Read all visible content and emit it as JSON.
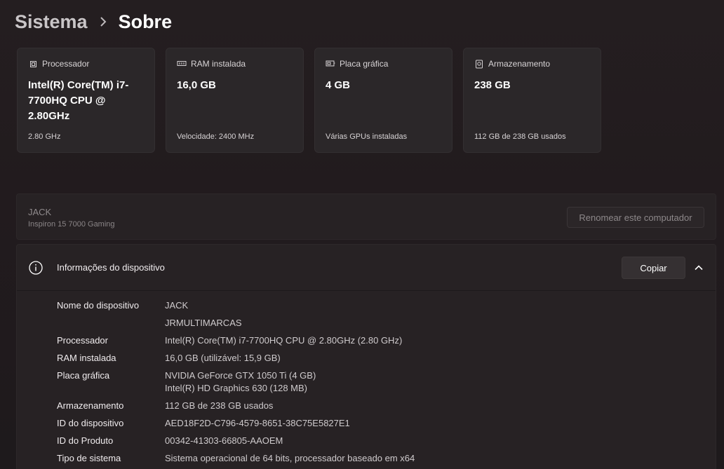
{
  "breadcrumb": {
    "parent": "Sistema",
    "separator": "›",
    "current": "Sobre"
  },
  "cards": [
    {
      "icon": "processor-icon",
      "label": "Processador",
      "value": "Intel(R) Core(TM) i7-7700HQ CPU @ 2.80GHz",
      "sub": "2.80 GHz"
    },
    {
      "icon": "ram-icon",
      "label": "RAM instalada",
      "value": "16,0 GB",
      "sub": "Velocidade: 2400 MHz"
    },
    {
      "icon": "gpu-icon",
      "label": "Placa gráfica",
      "value": "4 GB",
      "sub": "Várias GPUs instaladas"
    },
    {
      "icon": "storage-icon",
      "label": "Armazenamento",
      "value": "238 GB",
      "sub": "112 GB de 238 GB usados"
    }
  ],
  "rename": {
    "name": "JACK",
    "model": "Inspiron 15 7000 Gaming",
    "button": "Renomear este computador"
  },
  "device_info": {
    "title": "Informações do dispositivo",
    "copy_label": "Copiar",
    "rows": [
      {
        "label": "Nome do dispositivo",
        "values": [
          "JACK",
          "JRMULTIMARCAS"
        ]
      },
      {
        "label": "Processador",
        "values": [
          "Intel(R) Core(TM) i7-7700HQ CPU @ 2.80GHz (2.80 GHz)"
        ]
      },
      {
        "label": "RAM instalada",
        "values": [
          "16,0 GB (utilizável: 15,9 GB)"
        ]
      },
      {
        "label": "Placa gráfica",
        "values": [
          "NVIDIA GeForce GTX 1050 Ti (4 GB)",
          "Intel(R) HD Graphics 630 (128 MB)"
        ]
      },
      {
        "label": "Armazenamento",
        "values": [
          "112 GB de 238 GB usados"
        ]
      },
      {
        "label": "ID do dispositivo",
        "values": [
          "AED18F2D-C796-4579-8651-38C75E5827E1"
        ]
      },
      {
        "label": "ID do Produto",
        "values": [
          "00342-41303-66805-AAOEM"
        ]
      },
      {
        "label": "Tipo de sistema",
        "values": [
          "Sistema operacional de 64 bits, processador baseado em x64"
        ]
      }
    ]
  }
}
